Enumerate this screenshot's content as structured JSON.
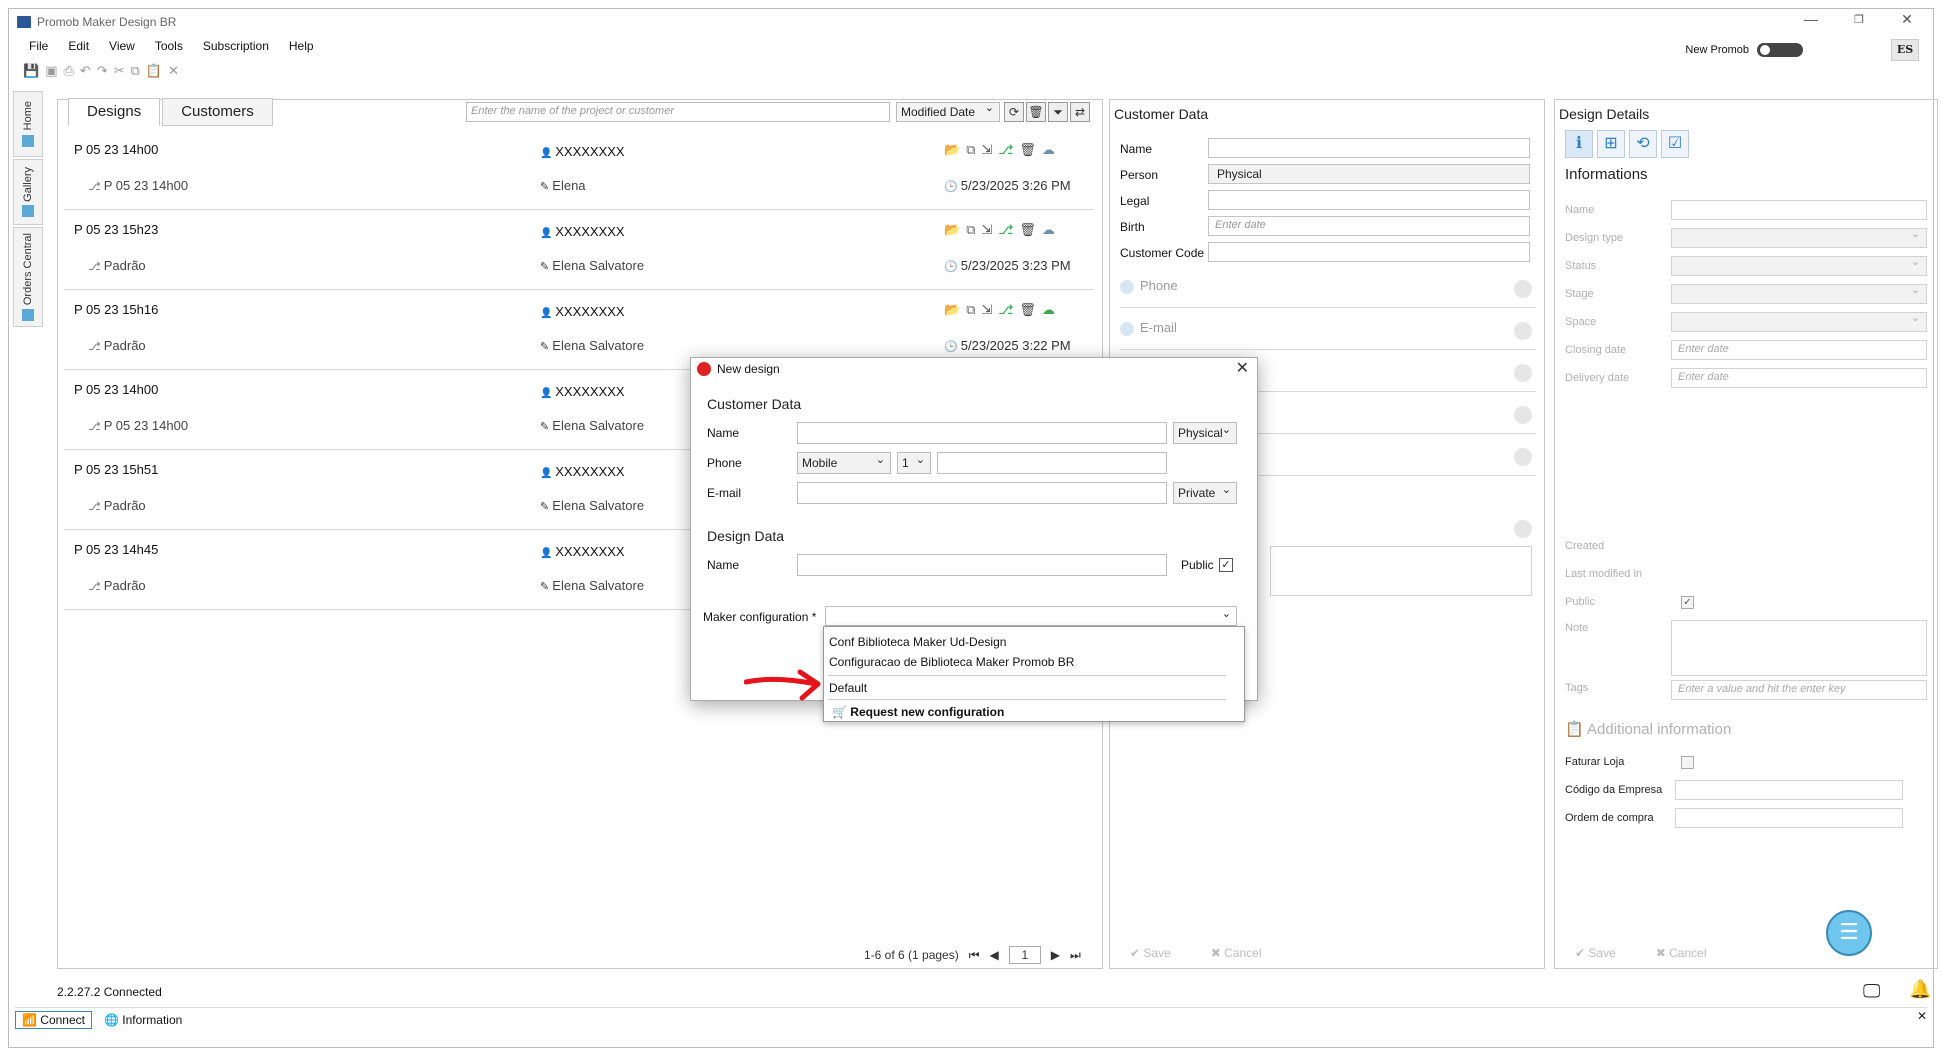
{
  "window": {
    "title": "Promob Maker Design BR",
    "minimize": "—",
    "restore": "❐",
    "close": "✕"
  },
  "menu": [
    "File",
    "Edit",
    "View",
    "Tools",
    "Subscription",
    "Help"
  ],
  "header": {
    "new_promob": "New Promob",
    "avatar": "ES"
  },
  "sidebar": [
    "Home",
    "Gallery",
    "Orders Central"
  ],
  "designs": {
    "tabs": [
      "Designs",
      "Customers"
    ],
    "search_placeholder": "Enter the name of the project or customer",
    "sort": "Modified Date",
    "rows": [
      {
        "name": "P 05 23 14h00",
        "sub": "P 05 23 14h00",
        "customer": "XXXXXXXX",
        "author": "Elena",
        "date": "5/23/2025 3:26 PM"
      },
      {
        "name": "P 05 23 15h23",
        "sub": "Padrão",
        "customer": "XXXXXXXX",
        "author": "Elena Salvatore",
        "date": "5/23/2025 3:23 PM"
      },
      {
        "name": "P 05 23 15h16",
        "sub": "Padrão",
        "customer": "XXXXXXXX",
        "author": "Elena Salvatore",
        "date": "5/23/2025 3:22 PM"
      },
      {
        "name": "P 05 23 14h00",
        "sub": "P 05 23 14h00",
        "customer": "XXXXXXXX",
        "author": "Elena Salvatore",
        "date": ""
      },
      {
        "name": "P 05 23 15h51",
        "sub": "Padrão",
        "customer": "XXXXXXXX",
        "author": "Elena Salvatore",
        "date": ""
      },
      {
        "name": "P 05 23 14h45",
        "sub": "Padrão",
        "customer": "XXXXXXXX",
        "author": "Elena Salvatore",
        "date": ""
      }
    ],
    "pager_text": "1-6 of 6 (1 pages)",
    "page": "1"
  },
  "customer": {
    "title": "Customer Data",
    "labels": {
      "name": "Name",
      "person": "Person",
      "legal": "Legal",
      "birth": "Birth",
      "code": "Customer Code"
    },
    "person_value": "Physical",
    "birth_placeholder": "Enter date",
    "sections": {
      "phone": "Phone",
      "email": "E-mail"
    },
    "save": "Save",
    "cancel": "Cancel"
  },
  "details": {
    "title": "Design Details",
    "subtitle": "Informations",
    "labels": {
      "name": "Name",
      "design_type": "Design type",
      "status": "Status",
      "stage": "Stage",
      "space": "Space",
      "closing": "Closing date",
      "delivery": "Delivery date",
      "created": "Created",
      "modified": "Last modified in",
      "public": "Public",
      "note": "Note",
      "tags": "Tags"
    },
    "date_placeholder": "Enter date",
    "tags_placeholder": "Enter a value and hit the enter key",
    "additional": "Additional information",
    "extra": {
      "faturar": "Faturar Loja",
      "codigo": "Código da Empresa",
      "ordem": "Ordem de compra"
    },
    "save": "Save",
    "cancel": "Cancel"
  },
  "status": {
    "version": "2.2.27.2 Connected",
    "connect": "Connect",
    "information": "Information"
  },
  "dialog": {
    "title": "New design",
    "customer_section": "Customer Data",
    "name_label": "Name",
    "person_type": "Physical",
    "phone_label": "Phone",
    "phone_type": "Mobile",
    "phone_code": "1",
    "email_label": "E-mail",
    "email_type": "Private",
    "design_section": "Design Data",
    "design_name_label": "Name",
    "public_label": "Public",
    "maker_label": "Maker configuration *",
    "options": [
      "Conf Biblioteca Maker Ud-Design",
      "Configuracao de Biblioteca Maker Promob BR",
      "Default"
    ],
    "request": "Request new configuration"
  }
}
